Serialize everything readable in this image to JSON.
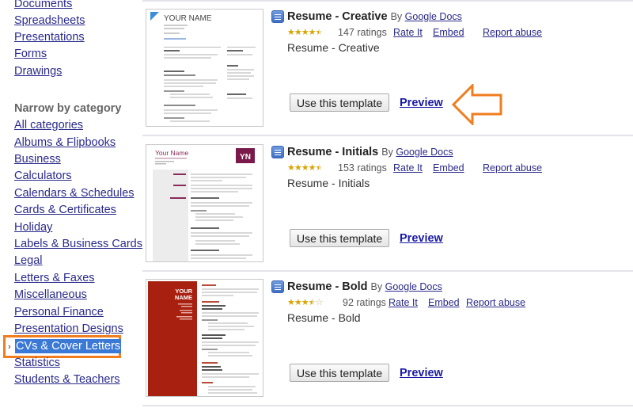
{
  "sidebar": {
    "type_links": [
      {
        "label": "Documents"
      },
      {
        "label": "Spreadsheets"
      },
      {
        "label": "Presentations"
      },
      {
        "label": "Forms"
      },
      {
        "label": "Drawings"
      }
    ],
    "category_heading": "Narrow by category",
    "categories": [
      {
        "label": "All categories"
      },
      {
        "label": "Albums & Flipbooks"
      },
      {
        "label": "Business"
      },
      {
        "label": "Calculators"
      },
      {
        "label": "Calendars & Schedules"
      },
      {
        "label": "Cards & Certificates"
      },
      {
        "label": "Holiday"
      },
      {
        "label": "Labels & Business Cards"
      },
      {
        "label": "Legal"
      },
      {
        "label": "Letters & Faxes"
      },
      {
        "label": "Miscellaneous"
      },
      {
        "label": "Personal Finance"
      },
      {
        "label": "Presentation Designs"
      },
      {
        "label": "CVs & Cover Letters",
        "selected": true
      },
      {
        "label": "Statistics"
      },
      {
        "label": "Students & Teachers"
      }
    ],
    "selected_marker": "›",
    "highlight_color": "#f07d1e"
  },
  "templates": [
    {
      "title": "Resume - Creative",
      "by_label": "By",
      "author": "Google Docs",
      "rating": 4.5,
      "ratings_count": "147 ratings",
      "rate_label": "Rate It",
      "embed_label": "Embed",
      "report_label": "Report abuse",
      "description": "Resume - Creative",
      "use_label": "Use this template",
      "preview_label": "Preview",
      "thumbnail": {
        "heading": "YOUR NAME",
        "accent": "#3a8fd6"
      },
      "callout_arrow": true
    },
    {
      "title": "Resume - Initials",
      "by_label": "By",
      "author": "Google Docs",
      "rating": 4.5,
      "ratings_count": "153 ratings",
      "rate_label": "Rate It",
      "embed_label": "Embed",
      "report_label": "Report abuse",
      "description": "Resume - Initials",
      "use_label": "Use this template",
      "preview_label": "Preview",
      "thumbnail": {
        "heading": "Your Name",
        "initials": "YN",
        "accent": "#7a1a4a"
      }
    },
    {
      "title": "Resume - Bold",
      "by_label": "By",
      "author": "Google Docs",
      "rating": 3.5,
      "ratings_count": "92 ratings",
      "rate_label": "Rate It",
      "embed_label": "Embed",
      "report_label": "Report abuse",
      "description": "Resume - Bold",
      "use_label": "Use this template",
      "preview_label": "Preview",
      "thumbnail": {
        "heading_line1": "YOUR",
        "heading_line2": "NAME",
        "accent": "#a82010"
      }
    }
  ],
  "colors": {
    "link": "#2a2a8c",
    "preview_link": "#1a1aa6",
    "callout": "#f07d1e",
    "selection_bg": "#3b79d6"
  }
}
